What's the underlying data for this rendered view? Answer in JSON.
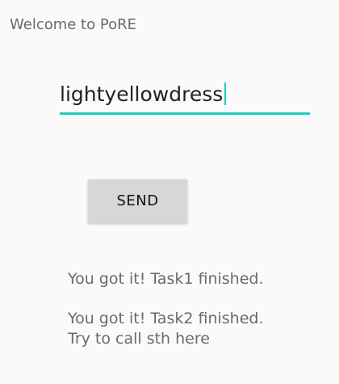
{
  "app": {
    "title": "Welcome to PoRE"
  },
  "input": {
    "value": "lightyellowdress",
    "accent_color": "#1ecdc0"
  },
  "send_button": {
    "label": "SEND"
  },
  "status": {
    "task1": "You got it! Task1 finished.",
    "task2_line1": "You got it! Task2 finished.",
    "task2_line2": "Try to call sth here"
  }
}
